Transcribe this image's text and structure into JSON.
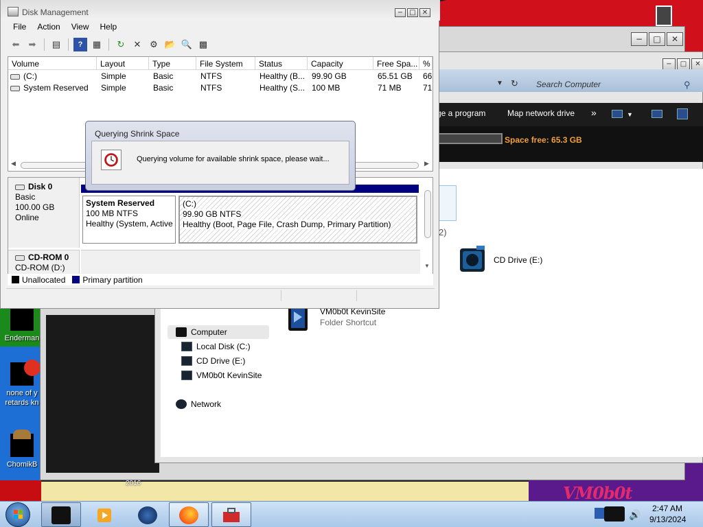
{
  "desktop": {
    "icons": [
      {
        "label": "Enderman"
      },
      {
        "label_line1": "none of y",
        "label_line2": "retards kn"
      },
      {
        "label": "ChomikB"
      }
    ],
    "wallpaper_year": "2016",
    "wallpaper_brand": "VM0b0t"
  },
  "explorer": {
    "caption_buttons": {
      "minimize": "−",
      "maximize": "□",
      "close": "✕"
    },
    "search_placeholder": "Search Computer",
    "toolbar": {
      "uninstall": "ge a program",
      "map_drive": "Map network drive",
      "more": "»"
    },
    "space_free": "Space free: 65.3 GB",
    "group_count": "2)",
    "items": [
      {
        "name": "CD Drive (E:)"
      },
      {
        "name": "VM0b0t KevinSite",
        "subtitle": "Folder Shortcut"
      }
    ],
    "nav": {
      "computer": "Computer",
      "local_disk": "Local Disk (C:)",
      "cd_drive": "CD Drive (E:)",
      "kevinsite": "VM0b0t KevinSite",
      "network": "Network"
    }
  },
  "disk_management": {
    "title": "Disk Management",
    "menu": [
      "File",
      "Action",
      "View",
      "Help"
    ],
    "columns": [
      "Volume",
      "Layout",
      "Type",
      "File System",
      "Status",
      "Capacity",
      "Free Spa...",
      "%"
    ],
    "rows": [
      {
        "volume": "(C:)",
        "layout": "Simple",
        "type": "Basic",
        "fs": "NTFS",
        "status": "Healthy (B...",
        "capacity": "99.90 GB",
        "free": "65.51 GB",
        "pct": "66"
      },
      {
        "volume": "System Reserved",
        "layout": "Simple",
        "type": "Basic",
        "fs": "NTFS",
        "status": "Healthy (S...",
        "capacity": "100 MB",
        "free": "71 MB",
        "pct": "71"
      }
    ],
    "disk0": {
      "name": "Disk 0",
      "type": "Basic",
      "size": "100.00 GB",
      "state": "Online",
      "partitions": [
        {
          "name": "System Reserved",
          "size": "100 MB NTFS",
          "status": "Healthy (System, Active"
        },
        {
          "name": "(C:)",
          "size": "99.90 GB NTFS",
          "status": "Healthy (Boot, Page File, Crash Dump, Primary Partition)"
        }
      ]
    },
    "cdrom": {
      "name": "CD-ROM 0",
      "drive": "CD-ROM (D:)"
    },
    "legend": [
      {
        "label": "Unallocated",
        "color": "#000000"
      },
      {
        "label": "Primary partition",
        "color": "#000080"
      }
    ]
  },
  "dialog": {
    "title": "Querying Shrink Space",
    "message": "Querying volume for available shrink space, please wait..."
  },
  "taskbar": {
    "time": "2:47 AM",
    "date": "9/13/2024"
  }
}
